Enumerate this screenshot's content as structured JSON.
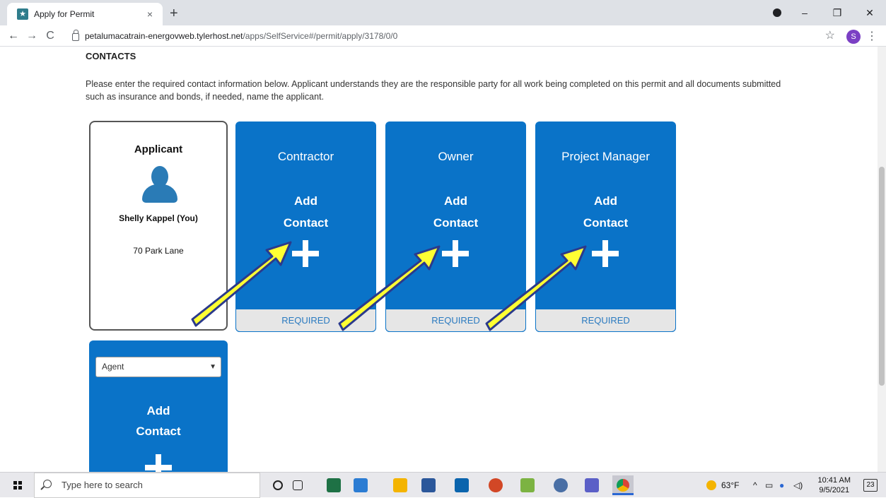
{
  "browser": {
    "tab_title": "Apply for Permit",
    "tab_close": "×",
    "new_tab": "+",
    "url_host": "petalumacatrain-energovweb.tylerhost.net",
    "url_path": "/apps/SelfService#/permit/apply/3178/0/0",
    "profile_initial": "S",
    "window_controls": {
      "minimize": "–",
      "restore": "❐",
      "close": "✕"
    },
    "nav": {
      "back": "←",
      "forward": "→",
      "reload": "C"
    },
    "star": "☆",
    "menu": "⋮"
  },
  "page": {
    "section_title": "CONTACTS",
    "intro": "Please enter the required contact information below. Applicant understands they are the responsible party for all work being completed on this permit and all documents submitted such as insurance and bonds, if needed, name the applicant.",
    "applicant": {
      "title": "Applicant",
      "name": "Shelly Kappel (You)",
      "address": "70 Park Lane"
    },
    "contact_cards": [
      {
        "title": "Contractor",
        "add_line1": "Add",
        "add_line2": "Contact",
        "status": "REQUIRED"
      },
      {
        "title": "Owner",
        "add_line1": "Add",
        "add_line2": "Contact",
        "status": "REQUIRED"
      },
      {
        "title": "Project Manager",
        "add_line1": "Add",
        "add_line2": "Contact",
        "status": "REQUIRED"
      }
    ],
    "agent_card": {
      "selected": "Agent",
      "add_line1": "Add",
      "add_line2": "Contact"
    }
  },
  "taskbar": {
    "search_placeholder": "Type here to search",
    "weather": "63°F",
    "time": "10:41 AM",
    "date": "9/5/2021",
    "notification_count": "23"
  },
  "colors": {
    "card_blue": "#0a73c8",
    "arrow_fill": "#ffff33",
    "arrow_outline": "#2b3a8c"
  }
}
